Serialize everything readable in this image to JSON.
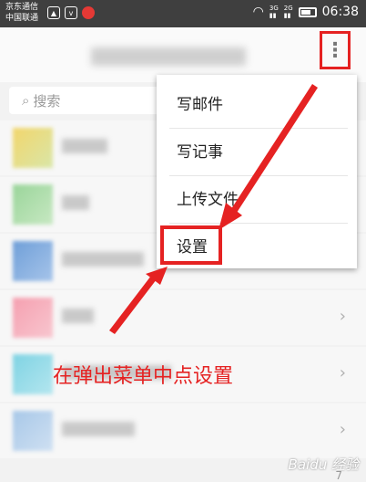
{
  "status_bar": {
    "carrier1": "京东通信",
    "carrier2": "中国联通",
    "net1": "3G",
    "net2": "2G",
    "time": "06:38"
  },
  "toolbar": {
    "more_icon": "⋮"
  },
  "search": {
    "placeholder": "搜索",
    "icon": "search-icon"
  },
  "menu": {
    "items": [
      "写邮件",
      "写记事",
      "上传文件",
      "设置"
    ]
  },
  "list": {
    "chevron": "›",
    "visible_number": "7"
  },
  "annotation": "在弹出菜单中点设置",
  "watermark": "Baidu 经验",
  "colors": {
    "accent": "#e52222",
    "status_bar": "#3f3f3f",
    "background": "#f2f2f2"
  }
}
